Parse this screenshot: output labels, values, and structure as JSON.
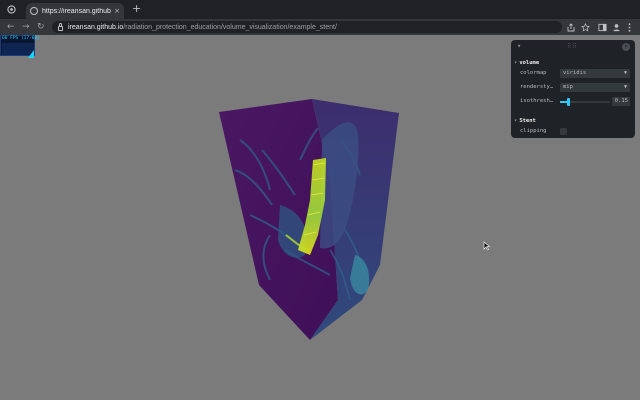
{
  "browser": {
    "tab": {
      "title": "https://ireansan.github.io/radiation_protection_education/volume_visualization/example_stent/"
    },
    "new_tab_glyph": "+",
    "tab_close_glyph": "×",
    "url": {
      "host": "ireansan.github.io",
      "path": "/radiation_protection_education/volume_visualization/example_stent/"
    },
    "nav": {
      "back": "←",
      "forward": "→",
      "reload": "↻"
    },
    "icons": [
      "chrome-menu-icon",
      "share-icon",
      "bookmark-star-icon",
      "sidebar-icon",
      "profile-icon",
      "more-menu-icon"
    ]
  },
  "stats": {
    "label": "60 FPS (17-60)"
  },
  "gui": {
    "close_glyph": "×",
    "collapse_glyph": "▾",
    "folders": [
      {
        "title": "volume",
        "controls": {
          "colormap": {
            "label": "colormap",
            "value": "viridis"
          },
          "renderstyle": {
            "label": "rendersty…",
            "value": "mip"
          },
          "isothreshold": {
            "label": "isothresh…",
            "value": "0.15",
            "level": 0.15
          }
        }
      },
      {
        "title": "Stent",
        "controls": {
          "clipping": {
            "label": "clipping",
            "checked": false
          }
        }
      }
    ]
  },
  "colors": {
    "page_background": "#7b7b7b",
    "volume_dark": "#44115b",
    "volume_mid": "#2e6a8e",
    "volume_bright": "#c8e020",
    "gui_accent": "#2cc9ff"
  }
}
